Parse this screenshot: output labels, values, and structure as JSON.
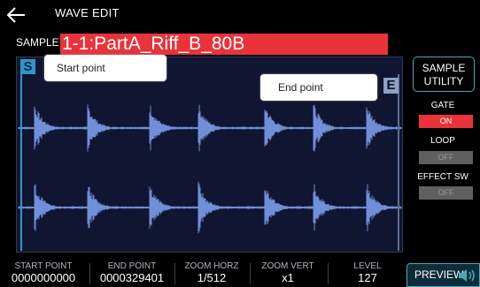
{
  "header": {
    "title": "WAVE EDIT"
  },
  "sample": {
    "label": "SAMPLE",
    "name": "1-1:PartA_Riff_B_80B"
  },
  "markers": {
    "start": "S",
    "end": "E"
  },
  "tooltips": {
    "start": "Start point",
    "end": "End point"
  },
  "side": {
    "utility_line1": "SAMPLE",
    "utility_line2": "UTILITY",
    "gate_label": "GATE",
    "gate_value": "ON",
    "loop_label": "LOOP",
    "loop_value": "OFF",
    "effect_label": "EFFECT SW",
    "effect_value": "OFF"
  },
  "params": [
    {
      "label": "START POINT",
      "value": "0000000000"
    },
    {
      "label": "END POINT",
      "value": "0000329401"
    },
    {
      "label": "ZOOM HORZ",
      "value": "1/512"
    },
    {
      "label": "ZOOM VERT",
      "value": "x1"
    },
    {
      "label": "LEVEL",
      "value": "127"
    }
  ],
  "preview": {
    "label": "PREVIEW"
  },
  "colors": {
    "accent_red": "#e8333b",
    "accent_teal": "#49a9b3",
    "wave": "#6f8fd8"
  },
  "icons": {
    "back": "back-arrow-icon",
    "speaker": "speaker-icon"
  }
}
